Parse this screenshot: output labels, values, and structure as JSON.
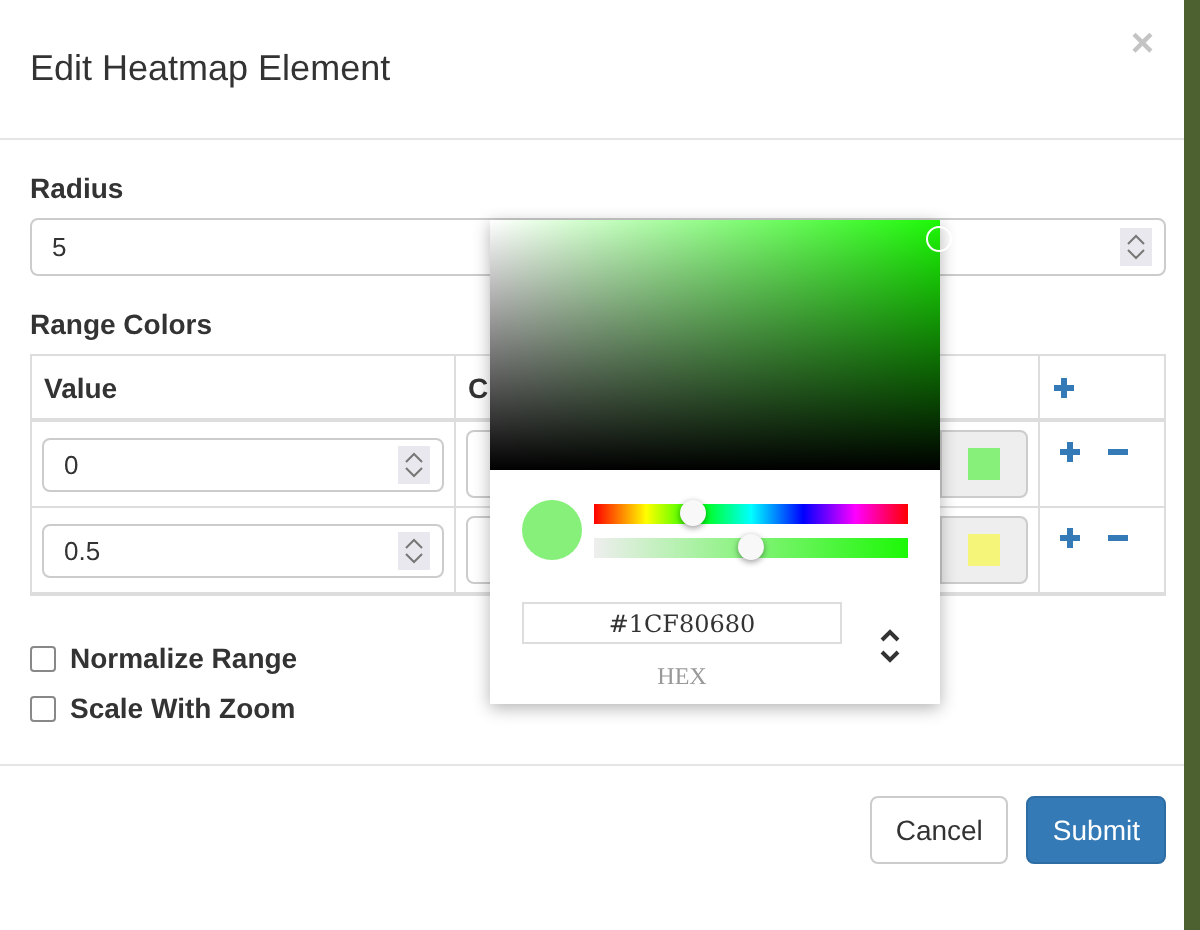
{
  "dialog": {
    "title": "Edit Heatmap Element",
    "close": "×"
  },
  "radius": {
    "label": "Radius",
    "value": "5"
  },
  "range_colors": {
    "label": "Range Colors",
    "columns": [
      "Value",
      "C"
    ],
    "rows": [
      {
        "value": "0",
        "color": "#86f07a"
      },
      {
        "value": "0.5",
        "color": "#f5f57a"
      }
    ]
  },
  "options": [
    {
      "label": "Normalize Range",
      "checked": false
    },
    {
      "label": "Scale With Zoom",
      "checked": false
    }
  ],
  "picker": {
    "hex": "#1CF80680",
    "format": "HEX",
    "hue": {
      "level": 0.32
    },
    "alpha": {
      "level": 0.5
    }
  },
  "buttons": [
    {
      "label": "Cancel",
      "kind": "default"
    },
    {
      "label": "Submit",
      "kind": "primary"
    }
  ]
}
